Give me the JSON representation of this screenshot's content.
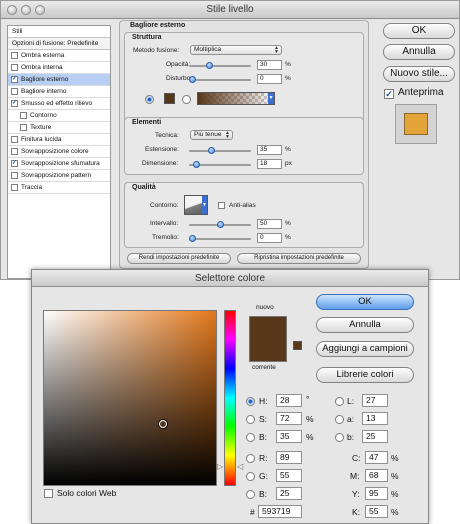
{
  "layer_style": {
    "title": "Stile livello",
    "sidebar": {
      "header": "Stili",
      "blend_options": "Opzioni di fusione: Predefinite",
      "items": [
        {
          "label": "Ombra esterna",
          "checked": false,
          "selected": false,
          "indent": false
        },
        {
          "label": "Ombra interna",
          "checked": false,
          "selected": false,
          "indent": false
        },
        {
          "label": "Bagliore esterno",
          "checked": true,
          "selected": true,
          "indent": false
        },
        {
          "label": "Bagliore interno",
          "checked": false,
          "selected": false,
          "indent": false
        },
        {
          "label": "Smusso ed effetto rilievo",
          "checked": true,
          "selected": false,
          "indent": false
        },
        {
          "label": "Contorno",
          "checked": false,
          "selected": false,
          "indent": true
        },
        {
          "label": "Texture",
          "checked": false,
          "selected": false,
          "indent": true
        },
        {
          "label": "Finitura lucida",
          "checked": false,
          "selected": false,
          "indent": false
        },
        {
          "label": "Sovrapposizione colore",
          "checked": false,
          "selected": false,
          "indent": false
        },
        {
          "label": "Sovrapposizione sfumatura",
          "checked": true,
          "selected": false,
          "indent": false
        },
        {
          "label": "Sovrapposizione pattern",
          "checked": false,
          "selected": false,
          "indent": false
        },
        {
          "label": "Traccia",
          "checked": false,
          "selected": false,
          "indent": false
        }
      ]
    },
    "section_title": "Bagliore esterno",
    "structure": {
      "title": "Struttura",
      "blend_mode_label": "Metodo fusione:",
      "blend_mode_value": "Moltiplica",
      "opacity_label": "Opacità:",
      "opacity_value": "30",
      "opacity_unit": "%",
      "opacity_fraction": 0.3,
      "noise_label": "Disturbo:",
      "noise_value": "0",
      "noise_unit": "%",
      "noise_fraction": 0,
      "swatch_color": "#593719"
    },
    "elements": {
      "title": "Elementi",
      "technique_label": "Tecnica:",
      "technique_value": "Più tenue",
      "spread_label": "Estensione:",
      "spread_value": "35",
      "spread_unit": "%",
      "spread_fraction": 0.35,
      "size_label": "Dimensione:",
      "size_value": "18",
      "size_unit": "px",
      "size_fraction": 0.072
    },
    "quality": {
      "title": "Qualità",
      "contour_label": "Contorno:",
      "antialias_label": "Anti-alias",
      "range_label": "Intervallo:",
      "range_value": "50",
      "range_unit": "%",
      "range_fraction": 0.5,
      "jitter_label": "Tremolio:",
      "jitter_value": "0",
      "jitter_unit": "%",
      "jitter_fraction": 0
    },
    "default_buttons": {
      "make_default": "Rendi impostazioni predefinite",
      "reset_default": "Ripristina impostazioni predefinite"
    },
    "buttons": {
      "ok": "OK",
      "cancel": "Annulla",
      "new_style": "Nuovo stile..."
    },
    "preview_label": "Anteprima",
    "preview_color": "#e3a43a"
  },
  "color_picker": {
    "title": "Selettore colore",
    "new_label": "nuovo",
    "current_label": "corrente",
    "new_color": "#593719",
    "current_color": "#593719",
    "web_only_label": "Solo colori Web",
    "buttons": {
      "ok": "OK",
      "cancel": "Annulla",
      "add_swatches": "Aggiungi a campioni",
      "color_libraries": "Librerie colori"
    },
    "hsb": [
      {
        "label": "H:",
        "value": "28",
        "unit": "°",
        "selected": true
      },
      {
        "label": "S:",
        "value": "72",
        "unit": "%",
        "selected": false
      },
      {
        "label": "B:",
        "value": "35",
        "unit": "%",
        "selected": false
      }
    ],
    "rgb": [
      {
        "label": "R:",
        "value": "89"
      },
      {
        "label": "G:",
        "value": "55"
      },
      {
        "label": "B:",
        "value": "25"
      }
    ],
    "lab": [
      {
        "label": "L:",
        "value": "27"
      },
      {
        "label": "a:",
        "value": "13"
      },
      {
        "label": "b:",
        "value": "25"
      }
    ],
    "cmyk": [
      {
        "label": "C:",
        "value": "47",
        "unit": "%"
      },
      {
        "label": "M:",
        "value": "68",
        "unit": "%"
      },
      {
        "label": "Y:",
        "value": "95",
        "unit": "%"
      },
      {
        "label": "K:",
        "value": "55",
        "unit": "%"
      }
    ],
    "hex_label": "#",
    "hex_value": "593719"
  }
}
